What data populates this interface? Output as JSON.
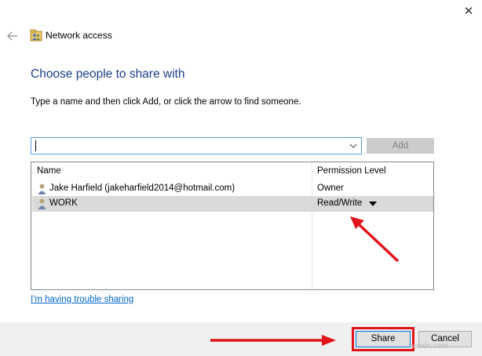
{
  "window": {
    "title": "Network access",
    "close_glyph": "✕",
    "back_icon": "back-arrow-icon",
    "title_icon": "network-users-icon"
  },
  "heading": "Choose people to share with",
  "instructions": "Type a name and then click Add, or click the arrow to find someone.",
  "name_input": {
    "value": "",
    "dropdown_icon": "chevron-down-icon"
  },
  "add_button": {
    "label": "Add",
    "enabled": false
  },
  "list": {
    "columns": [
      "Name",
      "Permission Level"
    ],
    "rows": [
      {
        "name": "Jake Harfield (jakeharfield2014@hotmail.com)",
        "permission": "Owner",
        "selected": false
      },
      {
        "name": "WORK",
        "permission": "Read/Write",
        "selected": true,
        "has_dropdown": true
      }
    ]
  },
  "trouble_link": "I'm having trouble sharing",
  "buttons": {
    "share": "Share",
    "cancel": "Cancel"
  },
  "watermark": "wsxdn.com",
  "colors": {
    "heading": "#1c3d8c",
    "link": "#0066cc",
    "annotation_red": "#e0141a",
    "selected_row": "#d9d9d9",
    "footer": "#f0f0f0"
  }
}
